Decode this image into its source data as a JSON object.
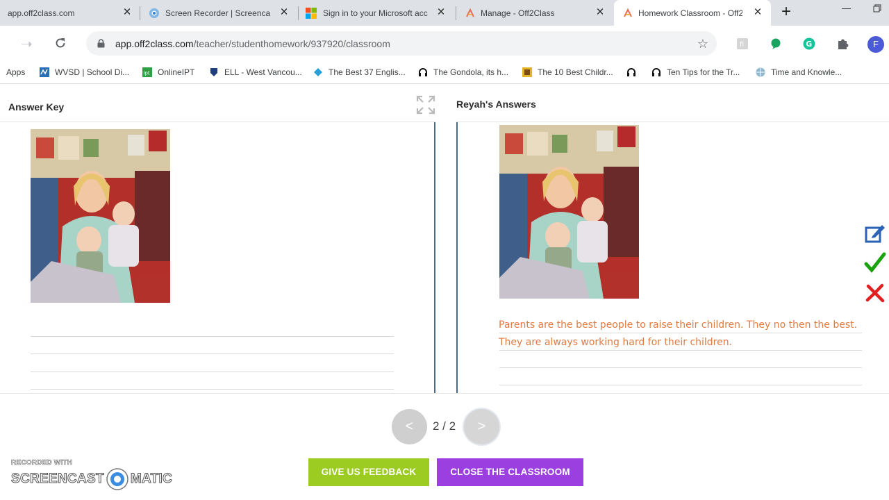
{
  "browser": {
    "tabs": [
      {
        "title": "app.off2class.com"
      },
      {
        "title": "Screen Recorder | Screencast-O-Matic"
      },
      {
        "title": "Sign in to your Microsoft account"
      },
      {
        "title": "Manage - Off2Class"
      },
      {
        "title": "Homework Classroom - Off2Class"
      }
    ],
    "url_host": "app.off2class.com",
    "url_path": "/teacher/studenthomework/937920/classroom",
    "profile_initial": "F",
    "bookmarks": [
      "Apps",
      "WVSD | School Di...",
      "OnlineIPT",
      "ELL - West Vancou...",
      "The Best 37 Englis...",
      "The Gondola, its h...",
      "The 10 Best Childr...",
      "",
      "Ten Tips for the Tr...",
      "Time and Knowle..."
    ],
    "colors": {
      "tabbar": "#dee1e6",
      "omnibox": "#f1f3f4"
    }
  },
  "page": {
    "answer_key_title": "Answer Key",
    "student_answers_title": "Reyah's Answers",
    "student_answer_text": "Parents are the best people to raise their children.  They no then the best.  They are always working hard for their children.",
    "pager": {
      "prev_label": "<",
      "next_label": ">",
      "current": "2",
      "total": "2",
      "display": "2 / 2"
    },
    "buttons": {
      "feedback_label": "GIVE US FEEDBACK",
      "close_label": "CLOSE THE CLASSROOM"
    },
    "side_tools": [
      "edit-icon",
      "check-icon",
      "cross-icon"
    ],
    "colors": {
      "answer_text": "#e07b42",
      "feedback_button": "#9ccc22",
      "close_button": "#9c3fe0",
      "divider": "#4b6a86",
      "check": "#19a10e",
      "cross": "#e02020",
      "edit": "#2a62b5"
    }
  },
  "watermark": {
    "line1": "RECORDED WITH",
    "line2_a": "SCREENCAST",
    "line2_b": "MATIC"
  }
}
